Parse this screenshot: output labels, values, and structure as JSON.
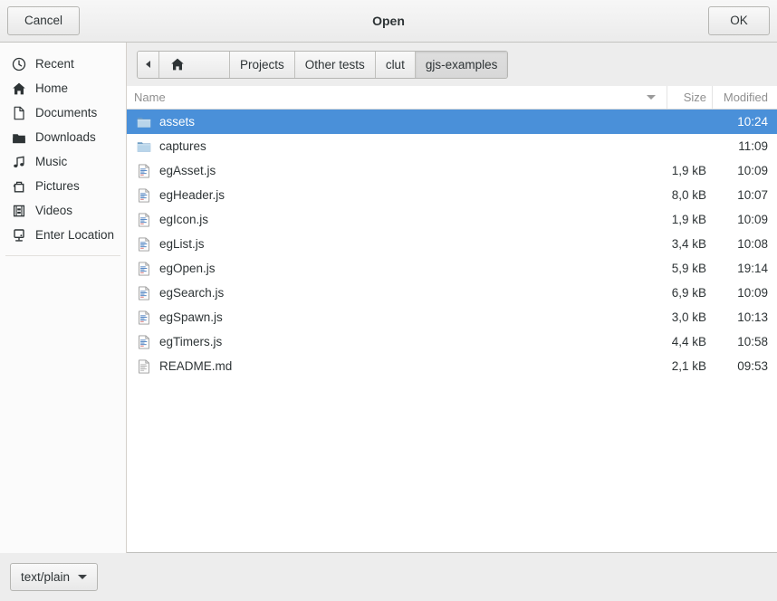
{
  "window": {
    "title": "Open",
    "cancel_label": "Cancel",
    "ok_label": "OK"
  },
  "colors": {
    "selection": "#4a90d9",
    "selection_text": "#ffffff",
    "chrome": "#ededed",
    "list_bg": "#ffffff",
    "folder_icon": "#98c1e0",
    "text": "#2e3436",
    "header_text": "#8f8f8f"
  },
  "sidebar": {
    "items": [
      {
        "label": "Recent",
        "icon": "clock-icon"
      },
      {
        "label": "Home",
        "icon": "home-icon"
      },
      {
        "label": "Documents",
        "icon": "document-icon"
      },
      {
        "label": "Downloads",
        "icon": "downloads-folder-icon"
      },
      {
        "label": "Music",
        "icon": "music-note-icon"
      },
      {
        "label": "Pictures",
        "icon": "camera-icon"
      },
      {
        "label": "Videos",
        "icon": "film-icon"
      },
      {
        "label": "Enter Location",
        "icon": "terminal-icon"
      }
    ]
  },
  "pathbar": {
    "back_icon": "chevron-left-icon",
    "home_icon": "home-icon",
    "crumbs": [
      {
        "label": "Projects",
        "active": false
      },
      {
        "label": "Other tests",
        "active": false
      },
      {
        "label": "clut",
        "active": false
      },
      {
        "label": "gjs-examples",
        "active": true
      }
    ]
  },
  "filelist": {
    "columns": {
      "name": "Name",
      "size": "Size",
      "modified": "Modified"
    },
    "sort_column": "Name",
    "sort_direction": "descending",
    "rows": [
      {
        "name": "assets",
        "size": "",
        "modified": "10:24",
        "type": "folder",
        "selected": true
      },
      {
        "name": "captures",
        "size": "",
        "modified": "11:09",
        "type": "folder",
        "selected": false
      },
      {
        "name": "egAsset.js",
        "size": "1,9 kB",
        "modified": "10:09",
        "type": "js",
        "selected": false
      },
      {
        "name": "egHeader.js",
        "size": "8,0 kB",
        "modified": "10:07",
        "type": "js",
        "selected": false
      },
      {
        "name": "egIcon.js",
        "size": "1,9 kB",
        "modified": "10:09",
        "type": "js",
        "selected": false
      },
      {
        "name": "egList.js",
        "size": "3,4 kB",
        "modified": "10:08",
        "type": "js",
        "selected": false
      },
      {
        "name": "egOpen.js",
        "size": "5,9 kB",
        "modified": "19:14",
        "type": "js",
        "selected": false
      },
      {
        "name": "egSearch.js",
        "size": "6,9 kB",
        "modified": "10:09",
        "type": "js",
        "selected": false
      },
      {
        "name": "egSpawn.js",
        "size": "3,0 kB",
        "modified": "10:13",
        "type": "js",
        "selected": false
      },
      {
        "name": "egTimers.js",
        "size": "4,4 kB",
        "modified": "10:58",
        "type": "js",
        "selected": false
      },
      {
        "name": "README.md",
        "size": "2,1 kB",
        "modified": "09:53",
        "type": "text",
        "selected": false
      }
    ]
  },
  "footer": {
    "filter_label": "text/plain",
    "filter_icon": "chevron-down-icon"
  }
}
